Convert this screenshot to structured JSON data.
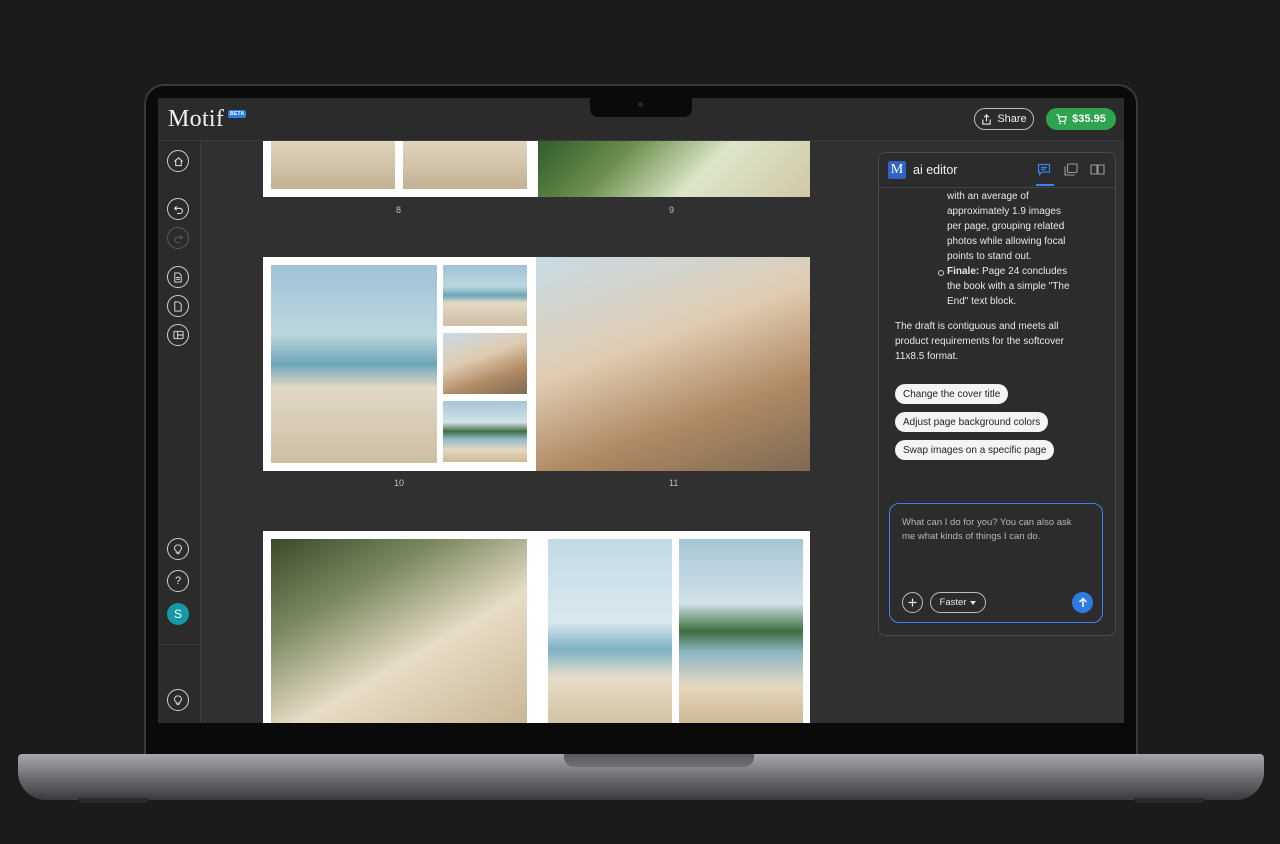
{
  "app": {
    "name": "Motif",
    "badge": "BETA",
    "share_label": "Share",
    "price_label": "$35.95"
  },
  "rail": {
    "icons": [
      "home-icon",
      "undo-icon",
      "redo-icon",
      "page-icon",
      "add-page-icon",
      "layout-icon",
      "lightbulb-icon",
      "help-icon",
      "avatar",
      "lightbulb-icon"
    ],
    "avatar_initial": "S",
    "help_glyph": "?"
  },
  "book": {
    "page_numbers": [
      "8",
      "9",
      "10",
      "11"
    ]
  },
  "ai_editor": {
    "title": "ai editor",
    "logo_letter": "M",
    "tabs": [
      "chat-icon",
      "gallery-icon",
      "book-icon"
    ],
    "messages": {
      "bullet_lines": [
        "with an average of",
        "approximately 1.9 images",
        "per page, grouping related",
        "photos while allowing focal",
        "points to stand out."
      ],
      "finale_label": "Finale:",
      "finale_lines": [
        " Page 24 concludes",
        "the book with a simple \"The",
        "End\" text block."
      ],
      "summary_lines": [
        "The draft is contiguous and meets all",
        "product requirements for the softcover",
        "11x8.5 format."
      ]
    },
    "suggestions": [
      "Change the cover title",
      "Adjust page background colors",
      "Swap images on a specific page"
    ],
    "input_placeholder_lines": [
      "What can I do for you?  You can also ask",
      "me what kinds of things I can do."
    ],
    "mode_label": "Faster"
  },
  "colors": {
    "accent_green": "#2ea44f",
    "accent_blue": "#3b82f6",
    "avatar_teal": "#1599a8"
  }
}
